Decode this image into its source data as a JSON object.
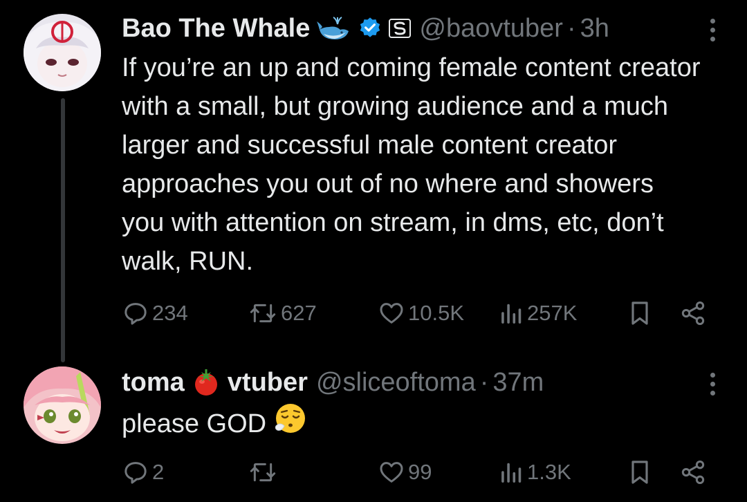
{
  "tweets": [
    {
      "author_name": "Bao The Whale",
      "handle": "@baovtuber",
      "separator": "·",
      "time": "3h",
      "text": "If you’re an up and coming female content creator with a small, but growing audience and a much larger and successful male content creator approaches you out of no where and showers you with attention on stream, in dms, etc, don’t walk, RUN.",
      "replies": "234",
      "reposts": "627",
      "likes": "10.5K",
      "views": "257K",
      "name_emoji_icon": "whale-icon",
      "verified_color": "#1d9bf0"
    },
    {
      "author_name_part1": "toma",
      "author_name_part2": "vtuber",
      "handle": "@sliceoftoma",
      "separator": "·",
      "time": "37m",
      "text": "please GOD",
      "replies": "2",
      "reposts": "",
      "likes": "99",
      "views": "1.3K",
      "name_emoji_icon": "tomato-icon",
      "text_emoji_icon": "exhaling-face-icon"
    }
  ],
  "colors": {
    "text": "#e7e9ea",
    "muted": "#71767b",
    "background": "#000000",
    "verified": "#1d9bf0",
    "thread_line": "#333639"
  }
}
